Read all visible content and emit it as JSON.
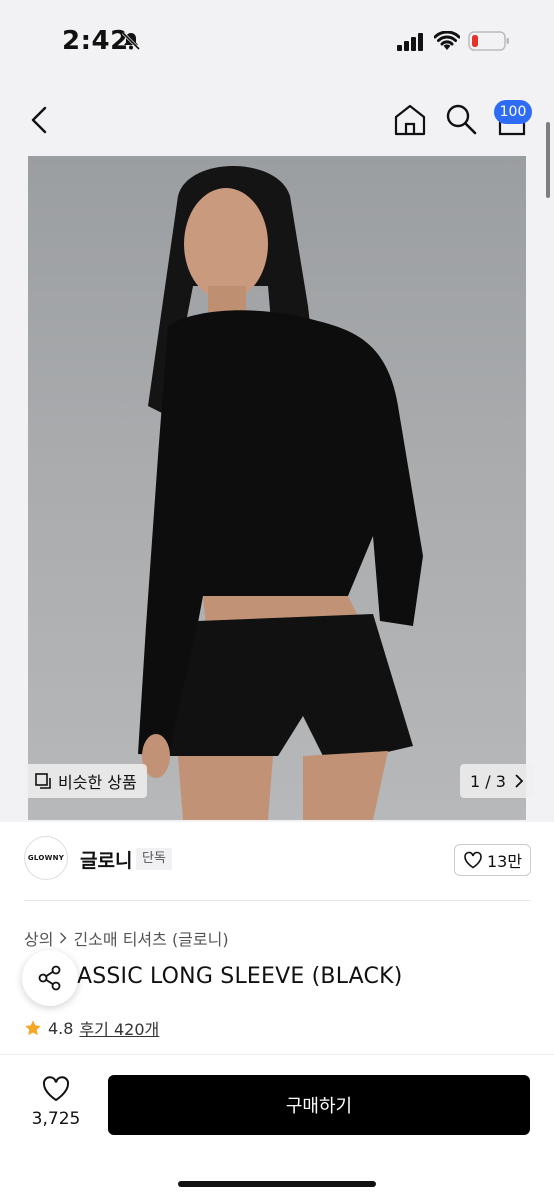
{
  "status": {
    "time": "2:42"
  },
  "nav": {
    "cart_badge": "100"
  },
  "image": {
    "similar_label": "비슷한 상품",
    "page": "1 / 3"
  },
  "brand": {
    "logo_text": "GLOWNY",
    "name": "글로니",
    "badge": "단독",
    "likes": "13만"
  },
  "breadcrumb": {
    "category": "상의",
    "subcategory": "긴소매 티셔츠 (글로니)"
  },
  "product": {
    "title": "G CLASSIC LONG SLEEVE (BLACK)",
    "rating": "4.8",
    "reviews": "후기 420개"
  },
  "bottom": {
    "wish_count": "3,725",
    "buy_label": "구매하기"
  },
  "colors": {
    "accent": "#2f6cf6",
    "buy_button": "#000000",
    "star": "#f5a623"
  }
}
